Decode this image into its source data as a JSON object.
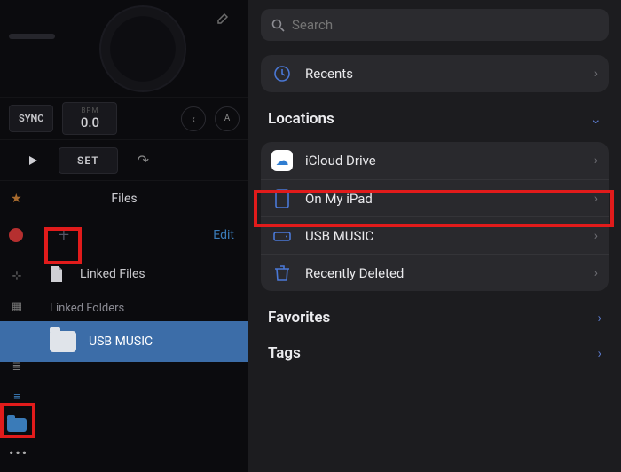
{
  "dj": {
    "sync_label": "SYNC",
    "bpm_label": "BPM",
    "bpm_value": "0.0",
    "set_label": "SET"
  },
  "files_panel": {
    "title": "Files",
    "edit_label": "Edit",
    "linked_files_label": "Linked Files",
    "linked_folders_label": "Linked Folders",
    "usb_music_label": "USB MUSIC"
  },
  "picker": {
    "search_placeholder": "Search",
    "recents_label": "Recents",
    "locations_label": "Locations",
    "icloud_label": "iCloud Drive",
    "on_my_ipad_label": "On My iPad",
    "usb_music_label": "USB MUSIC",
    "recently_deleted_label": "Recently Deleted",
    "favorites_label": "Favorites",
    "tags_label": "Tags"
  }
}
